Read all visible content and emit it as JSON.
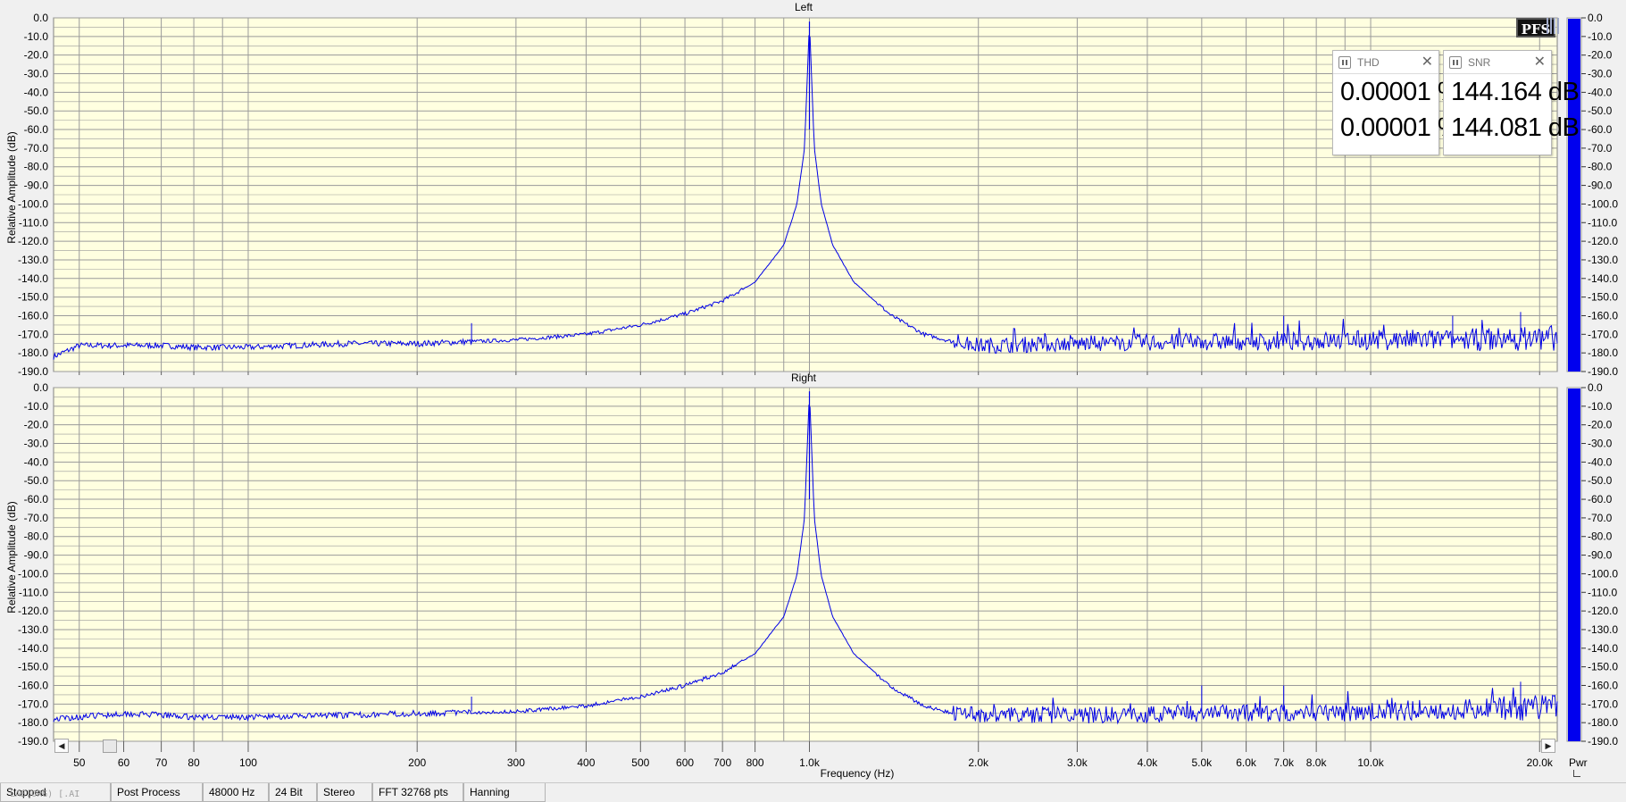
{
  "colors": {
    "plot_background": "#ffffe0",
    "grid": "#9a9a9a",
    "trace": "#0000e6",
    "meter_fill": "#0000ee",
    "meter_background": "#ffffff"
  },
  "panels": {
    "left_title": "Left",
    "right_title": "Right",
    "ylabel": "Relative Amplitude (dB)",
    "xlabel": "Frequency (Hz)"
  },
  "chart_data": [
    {
      "type": "line",
      "title": "Left",
      "xlabel": "Frequency (Hz)",
      "ylabel": "Relative Amplitude (dB)",
      "x_scale": "log",
      "xlim": [
        45,
        21500
      ],
      "ylim": [
        -190,
        0
      ],
      "grid": true,
      "x_tick_labels": [
        "50",
        "60",
        "70",
        "80",
        "100",
        "200",
        "300",
        "400",
        "500",
        "600",
        "700",
        "800",
        "1.0k",
        "2.0k",
        "3.0k",
        "4.0k",
        "5.0k",
        "6.0k",
        "7.0k",
        "8.0k",
        "10.0k",
        "20.0k"
      ],
      "y_tick_labels": [
        "0.0",
        "-10.0",
        "-20.0",
        "-30.0",
        "-40.0",
        "-50.0",
        "-60.0",
        "-70.0",
        "-80.0",
        "-90.0",
        "-100.0",
        "-110.0",
        "-120.0",
        "-130.0",
        "-140.0",
        "-150.0",
        "-160.0",
        "-170.0",
        "-180.0",
        "-190.0"
      ],
      "series": [
        {
          "x": [
            45,
            50,
            60,
            70,
            80,
            100,
            150,
            200,
            300,
            400,
            500,
            600,
            700,
            800,
            900,
            950,
            980,
            1000,
            1020,
            1050,
            1100,
            1200,
            1400,
            1600,
            1800,
            2000,
            3000,
            5000,
            7000,
            10000,
            15000,
            20000,
            21500
          ],
          "y": [
            -182,
            -176,
            -176,
            -176,
            -177,
            -177,
            -175,
            -175,
            -173,
            -170,
            -165,
            -159,
            -152,
            -142,
            -122,
            -100,
            -70,
            -2,
            -70,
            -100,
            -122,
            -142,
            -160,
            -170,
            -174,
            -176,
            -175,
            -174,
            -174,
            -173,
            -173,
            -172,
            -172
          ]
        }
      ],
      "spurs": [
        {
          "x": 250,
          "y": -164
        },
        {
          "x": 7000,
          "y": -160
        },
        {
          "x": 14000,
          "y": -160
        },
        {
          "x": 18500,
          "y": -158
        }
      ]
    },
    {
      "type": "line",
      "title": "Right",
      "xlabel": "Frequency (Hz)",
      "ylabel": "Relative Amplitude (dB)",
      "x_scale": "log",
      "xlim": [
        45,
        21500
      ],
      "ylim": [
        -190,
        0
      ],
      "grid": true,
      "x_tick_labels": [
        "50",
        "60",
        "70",
        "80",
        "100",
        "200",
        "300",
        "400",
        "500",
        "600",
        "700",
        "800",
        "1.0k",
        "2.0k",
        "3.0k",
        "4.0k",
        "5.0k",
        "6.0k",
        "7.0k",
        "8.0k",
        "10.0k",
        "20.0k"
      ],
      "y_tick_labels": [
        "0.0",
        "-10.0",
        "-20.0",
        "-30.0",
        "-40.0",
        "-50.0",
        "-60.0",
        "-70.0",
        "-80.0",
        "-90.0",
        "-100.0",
        "-110.0",
        "-120.0",
        "-130.0",
        "-140.0",
        "-150.0",
        "-160.0",
        "-170.0",
        "-180.0",
        "-190.0"
      ],
      "series": [
        {
          "x": [
            45,
            50,
            60,
            70,
            80,
            100,
            150,
            200,
            300,
            400,
            500,
            600,
            700,
            800,
            900,
            950,
            980,
            1000,
            1020,
            1050,
            1100,
            1200,
            1400,
            1600,
            1800,
            2000,
            3000,
            5000,
            7000,
            10000,
            15000,
            20000,
            21500
          ],
          "y": [
            -178,
            -177,
            -175,
            -176,
            -177,
            -177,
            -176,
            -175,
            -174,
            -171,
            -166,
            -160,
            -153,
            -143,
            -123,
            -101,
            -70,
            -2,
            -70,
            -101,
            -123,
            -143,
            -161,
            -171,
            -175,
            -176,
            -176,
            -175,
            -175,
            -174,
            -173,
            -172,
            -172
          ]
        }
      ],
      "spurs": [
        {
          "x": 250,
          "y": -166
        },
        {
          "x": 5000,
          "y": -160
        },
        {
          "x": 7000,
          "y": -160
        },
        {
          "x": 18500,
          "y": -158
        }
      ]
    }
  ],
  "meters": {
    "tick_labels": [
      "0.0",
      "-10.0",
      "-20.0",
      "-30.0",
      "-40.0",
      "-50.0",
      "-60.0",
      "-70.0",
      "-80.0",
      "-90.0",
      "-100.0",
      "-110.0",
      "-120.0",
      "-130.0",
      "-140.0",
      "-150.0",
      "-160.0",
      "-170.0",
      "-180.0",
      "-190.0"
    ],
    "left_level_db": -0.5,
    "right_level_db": -0.5,
    "label": "Pwr"
  },
  "widgets": {
    "thd": {
      "title": "THD",
      "value_left": "0.00001 %",
      "value_right": "0.00001 %"
    },
    "snr": {
      "title": "SNR",
      "value_left": "144.164 dB",
      "value_right": "144.081 dB"
    }
  },
  "logo": {
    "text": "PFS"
  },
  "statusbar": {
    "state": "Stopped",
    "watermark": "LAE.ORG) [.AI",
    "post_process": "Post Process",
    "sample_rate": "48000 Hz",
    "bit_depth": "24 Bit",
    "channels": "Stereo",
    "fft": "FFT 32768 pts",
    "window": "Hanning"
  },
  "scroll": {
    "left_arrow": "◀",
    "right_arrow": "▶"
  }
}
